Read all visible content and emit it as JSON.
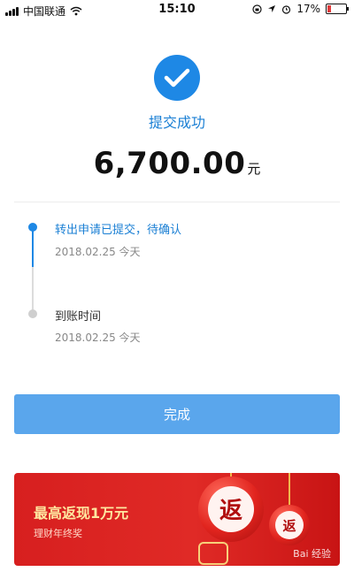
{
  "status_bar": {
    "carrier": "中国联通",
    "time": "15:10",
    "battery": "17%"
  },
  "result": {
    "title": "提交成功",
    "amount": "6,700.00",
    "unit": "元"
  },
  "timeline": [
    {
      "title": "转出申请已提交，待确认",
      "date": "2018.02.25",
      "day": "今天"
    },
    {
      "title": "到账时间",
      "date": "2018.02.25",
      "day": "今天"
    }
  ],
  "done_button": {
    "label": "完成"
  },
  "banner": {
    "title": "最高返现1万元",
    "subtitle": "理财年终奖",
    "orb_char": "返",
    "watermark": "Bai 经验"
  },
  "colors": {
    "accent": "#1e88e5",
    "button": "#5aa6ec",
    "banner_red": "#d71f1f"
  },
  "icons": [
    "signal-icon",
    "wifi-icon",
    "lock-rotation-icon",
    "location-icon",
    "alarm-icon",
    "battery-icon",
    "check-icon"
  ]
}
